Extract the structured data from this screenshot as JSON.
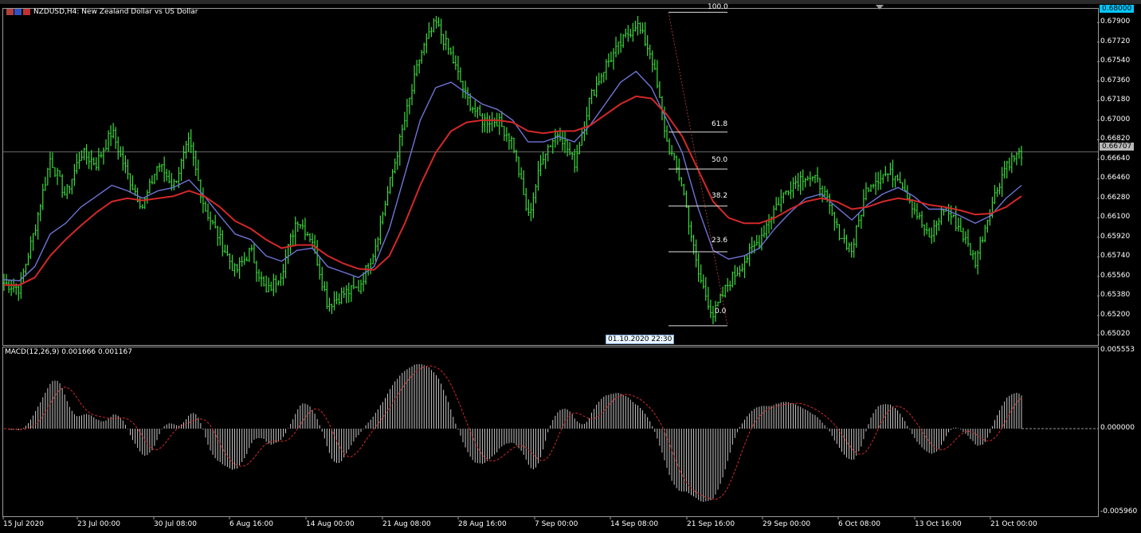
{
  "header": {
    "symbol_text": "NZDUSD,H4:  New Zealand Dollar vs US Dollar"
  },
  "price_axis": {
    "ticks": [
      "0.67900",
      "0.67720",
      "0.67540",
      "0.67360",
      "0.67180",
      "0.67000",
      "0.66820",
      "0.66640",
      "0.66460",
      "0.66280",
      "0.66100",
      "0.65920",
      "0.65740",
      "0.65560",
      "0.65380",
      "0.65200",
      "0.65020"
    ],
    "top_badge": "0.68000",
    "current_badge": "0.66707"
  },
  "macd_panel": {
    "label": "MACD(12,26,9) 0.001666 0.001167",
    "ticks": [
      "0.005553",
      "0.000000",
      "-0.005960"
    ]
  },
  "time_axis": {
    "labels": [
      "15 Jul 2020",
      "23 Jul 00:00",
      "30 Jul 08:00",
      "6 Aug 16:00",
      "14 Aug 00:00",
      "21 Aug 08:00",
      "28 Aug 16:00",
      "7 Sep 00:00",
      "14 Sep 08:00",
      "21 Sep 16:00",
      "29 Sep 00:00",
      "6 Oct 08:00",
      "13 Oct 16:00",
      "21 Oct 00:00"
    ]
  },
  "fibonacci": {
    "levels": [
      "100.0",
      "61.8",
      "50.0",
      "38.2",
      "23.6",
      "0.0"
    ]
  },
  "time_tag": {
    "text": "01.10.2020 22:30"
  },
  "colors": {
    "candles": "#3cdc3c",
    "ma_fast": "#6f74d6",
    "ma_slow": "#d42828",
    "macd_hist": "#c8c8c8",
    "macd_signal": "#d22a2a",
    "badge_top": "#00c8ff",
    "badge_current": "#b8b8b8"
  },
  "chart_data": {
    "type": "line",
    "title": "NZDUSD,H4:  New Zealand Dollar vs US Dollar",
    "x_labels": [
      "15 Jul 2020",
      "23 Jul 00:00",
      "30 Jul 08:00",
      "6 Aug 16:00",
      "14 Aug 00:00",
      "21 Aug 08:00",
      "28 Aug 16:00",
      "7 Sep 00:00",
      "14 Sep 08:00",
      "21 Sep 16:00",
      "29 Sep 00:00",
      "6 Oct 08:00",
      "13 Oct 16:00",
      "21 Oct 00:00"
    ],
    "ylim": [
      0.6495,
      0.6802
    ],
    "grid": false,
    "series": [
      {
        "values": [
          0.655,
          0.6545,
          0.66,
          0.6665,
          0.663,
          0.667,
          0.666,
          0.669,
          0.665,
          0.662,
          0.666,
          0.664,
          0.668,
          0.662,
          0.659,
          0.656,
          0.658,
          0.654,
          0.656,
          0.661,
          0.659,
          0.653,
          0.654,
          0.6545,
          0.658,
          0.664,
          0.67,
          0.676,
          0.679,
          0.676,
          0.672,
          0.67,
          0.67,
          0.668,
          0.661,
          0.667,
          0.669,
          0.666,
          0.672,
          0.675,
          0.677,
          0.679,
          0.676,
          0.668,
          0.664,
          0.656,
          0.652,
          0.655,
          0.657,
          0.659,
          0.662,
          0.664,
          0.665,
          0.664,
          0.66,
          0.658,
          0.664,
          0.665,
          0.665,
          0.662,
          0.659,
          0.662,
          0.66,
          0.657,
          0.662,
          0.666,
          0.667
        ]
      },
      {
        "values": [
          0.6553,
          0.6552,
          0.6565,
          0.6595,
          0.6605,
          0.662,
          0.663,
          0.664,
          0.6635,
          0.6628,
          0.6635,
          0.6638,
          0.6645,
          0.663,
          0.6612,
          0.6595,
          0.659,
          0.6575,
          0.657,
          0.658,
          0.6582,
          0.6565,
          0.656,
          0.6555,
          0.6565,
          0.66,
          0.665,
          0.67,
          0.673,
          0.6735,
          0.6725,
          0.6715,
          0.671,
          0.67,
          0.668,
          0.668,
          0.6685,
          0.668,
          0.6695,
          0.6715,
          0.6735,
          0.6745,
          0.673,
          0.67,
          0.667,
          0.662,
          0.658,
          0.6572,
          0.6575,
          0.6582,
          0.66,
          0.6615,
          0.6628,
          0.6632,
          0.662,
          0.6608,
          0.6622,
          0.6632,
          0.6638,
          0.663,
          0.6618,
          0.6618,
          0.6612,
          0.6605,
          0.6612,
          0.6628,
          0.664
        ]
      },
      {
        "values": [
          0.6548,
          0.6548,
          0.6555,
          0.6575,
          0.659,
          0.6603,
          0.6615,
          0.6625,
          0.6628,
          0.6626,
          0.6628,
          0.663,
          0.6635,
          0.663,
          0.662,
          0.6607,
          0.66,
          0.659,
          0.6582,
          0.6585,
          0.6585,
          0.6575,
          0.6568,
          0.6563,
          0.6562,
          0.6575,
          0.6605,
          0.664,
          0.667,
          0.669,
          0.6698,
          0.67,
          0.67,
          0.6698,
          0.669,
          0.6688,
          0.669,
          0.669,
          0.6695,
          0.6705,
          0.6715,
          0.6722,
          0.672,
          0.6705,
          0.6685,
          0.6655,
          0.6625,
          0.661,
          0.6605,
          0.6605,
          0.661,
          0.6618,
          0.6625,
          0.6628,
          0.6625,
          0.6618,
          0.662,
          0.6625,
          0.6628,
          0.6626,
          0.6622,
          0.662,
          0.6617,
          0.6613,
          0.6614,
          0.662,
          0.663
        ]
      }
    ]
  }
}
